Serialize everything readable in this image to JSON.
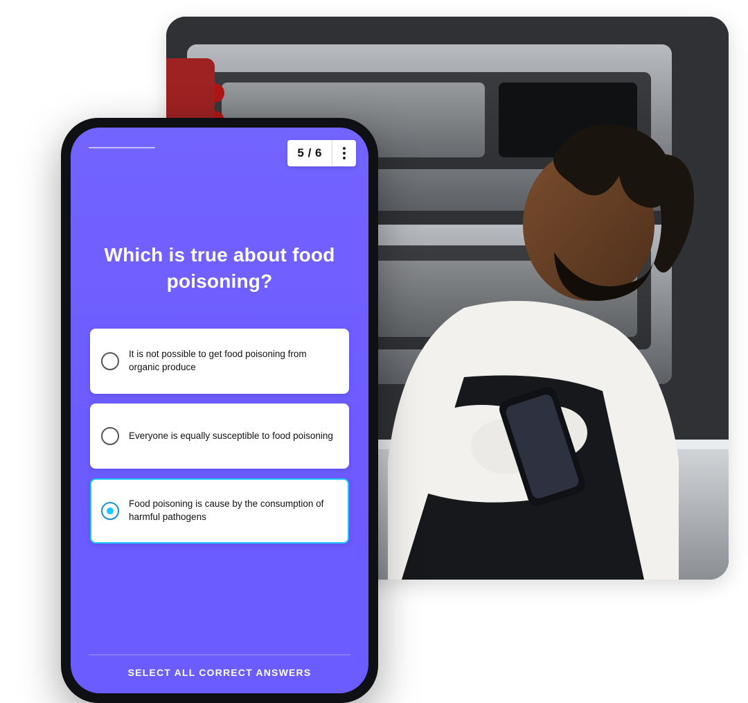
{
  "quiz": {
    "progress_label": "5 / 6",
    "question": "Which is true about food poisoning?",
    "options": [
      {
        "label": "It is not possible to get food poisoning from organic produce",
        "selected": false
      },
      {
        "label": "Everyone is equally susceptible to food poisoning",
        "selected": false
      },
      {
        "label": "Food poisoning is cause by the consumption of harmful pathogens",
        "selected": true
      }
    ],
    "instruction": "SELECT ALL CORRECT ANSWERS"
  },
  "colors": {
    "accent": "#6a5cff",
    "highlight": "#1ec8ff"
  }
}
